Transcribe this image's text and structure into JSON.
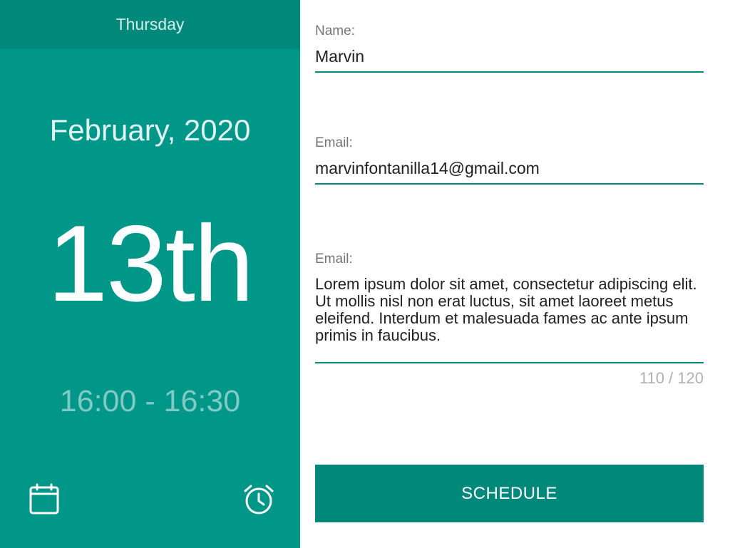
{
  "sidebar": {
    "weekday": "Thursday",
    "month_year": "February, 2020",
    "day": "13th",
    "time_range": "16:00 - 16:30",
    "calendar_icon": "calendar-icon",
    "alarm_icon": "alarm-clock-icon"
  },
  "form": {
    "name": {
      "label": "Name:",
      "value": "Marvin"
    },
    "email": {
      "label": "Email:",
      "value": "marvinfontanilla14@gmail.com"
    },
    "message": {
      "label": "Email:",
      "value": "Lorem ipsum dolor sit amet, consectetur adipiscing elit. Ut mollis nisl non erat luctus, sit amet laoreet metus eleifend. Interdum et malesuada fames ac ante ipsum primis in faucibus.",
      "counter": "110 / 120"
    },
    "submit_label": "SCHEDULE"
  },
  "colors": {
    "primary": "#009688",
    "primary_dark": "#00897b",
    "accent_light": "#80cbc4"
  }
}
